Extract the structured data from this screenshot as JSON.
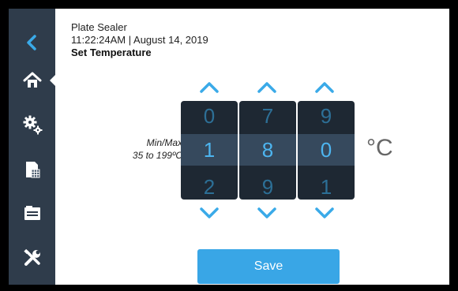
{
  "header": {
    "title": "Plate Sealer",
    "timestamp": "11:22:24AM | August 14, 2019",
    "subtitle": "Set Temperature"
  },
  "sidebar": {
    "items": [
      {
        "icon": "back-chevron-icon"
      },
      {
        "icon": "home-icon",
        "active": true
      },
      {
        "icon": "gears-icon"
      },
      {
        "icon": "plate-icon"
      },
      {
        "icon": "folder-icon"
      },
      {
        "icon": "tools-icon"
      }
    ]
  },
  "temperature": {
    "range_label": "Min/Max",
    "range_value": "35 to 199ºC",
    "unit": "°C",
    "digits": [
      {
        "prev": "0",
        "current": "1",
        "next": "2"
      },
      {
        "prev": "7",
        "current": "8",
        "next": "9"
      },
      {
        "prev": "9",
        "current": "0",
        "next": "1"
      }
    ]
  },
  "save_label": "Save",
  "colors": {
    "sidebar": "#2f3c4b",
    "accent": "#39a6e6",
    "drum": "#1e2833",
    "drum_selected": "#36495d"
  }
}
